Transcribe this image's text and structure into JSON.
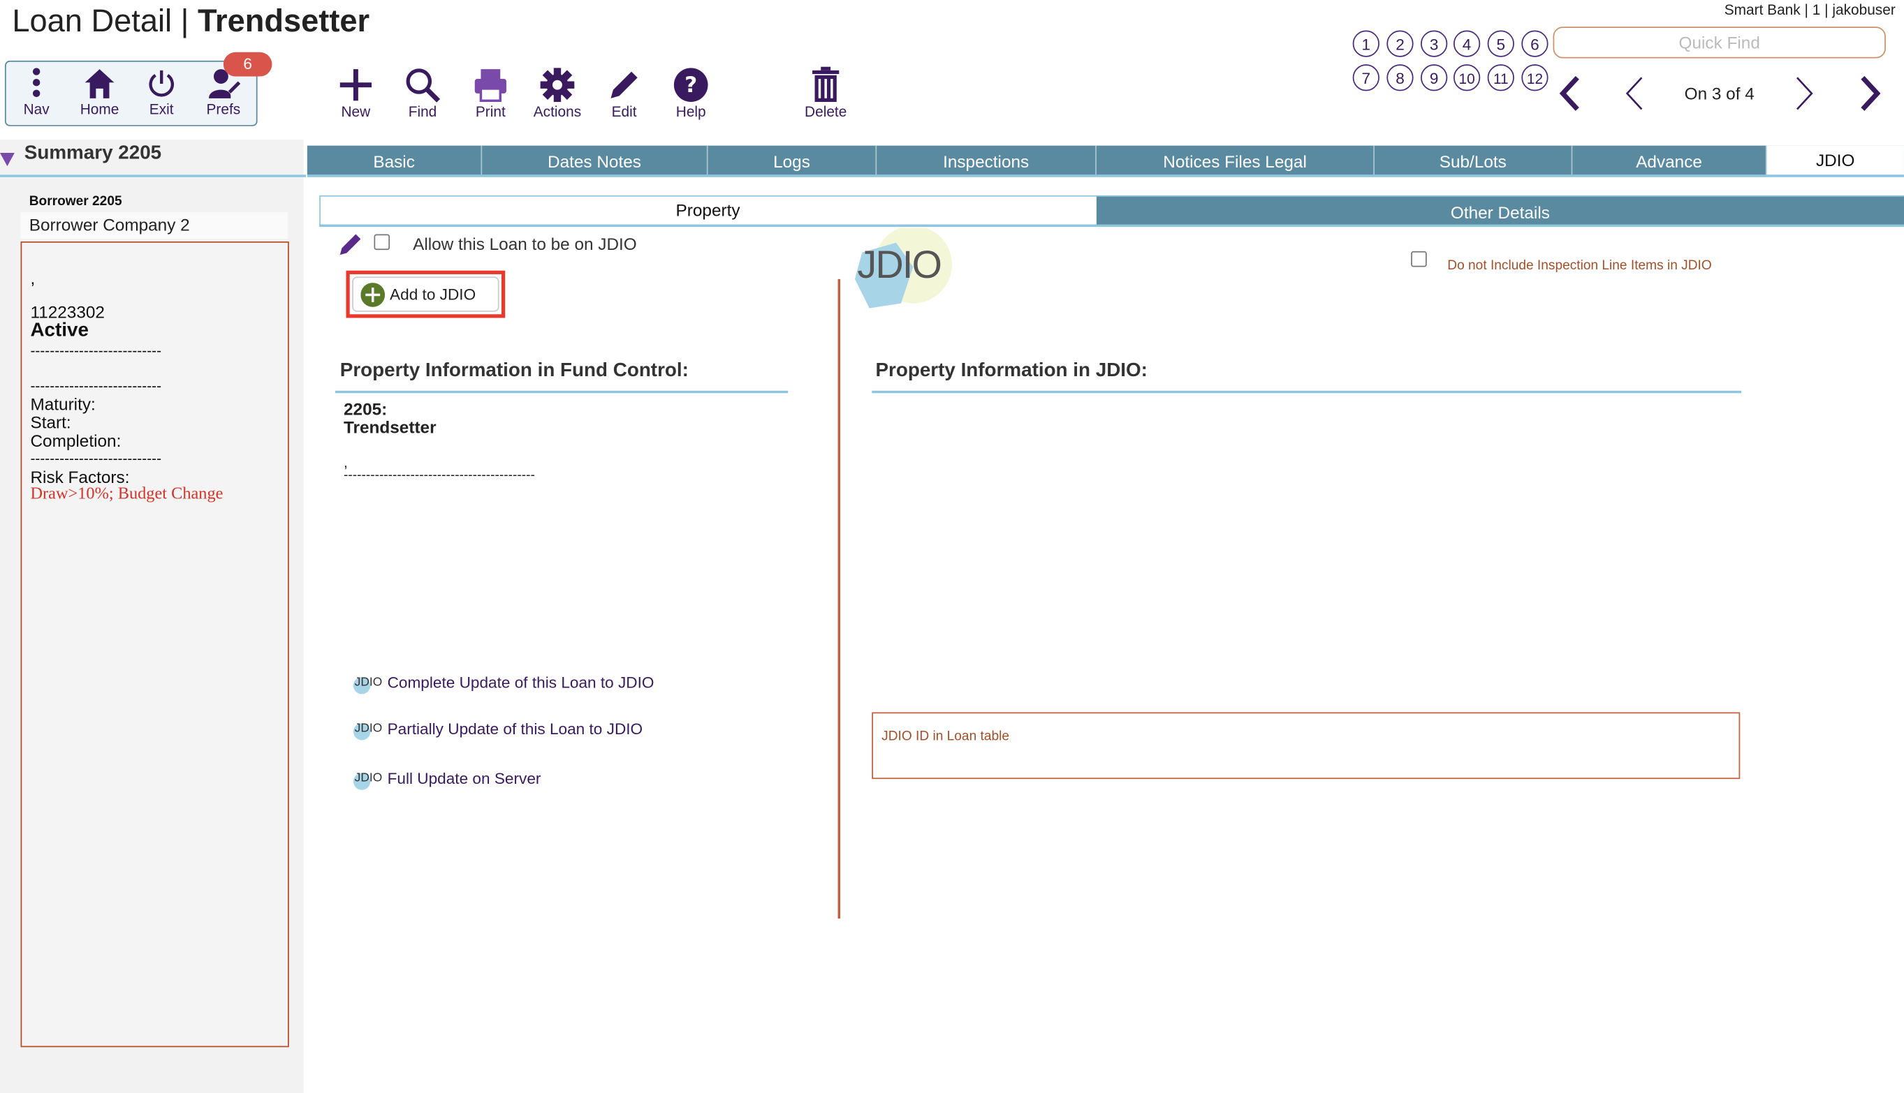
{
  "header": {
    "title_prefix": "Loan Detail | ",
    "title_bold": "Trendsetter",
    "user_info": "Smart Bank | 1 | jakobuser"
  },
  "nav": {
    "nav": "Nav",
    "home": "Home",
    "exit": "Exit",
    "prefs": "Prefs",
    "prefs_badge": "6"
  },
  "toolbar": {
    "new": "New",
    "find": "Find",
    "print": "Print",
    "actions": "Actions",
    "edit": "Edit",
    "help": "Help",
    "delete": "Delete"
  },
  "bookmarks": [
    "1",
    "2",
    "3",
    "4",
    "5",
    "6",
    "7",
    "8",
    "9",
    "10",
    "11",
    "12"
  ],
  "quickfind": {
    "placeholder": "Quick Find"
  },
  "record_nav": {
    "position": "On 3 of 4"
  },
  "summary": {
    "title": "Summary 2205",
    "borrower_label": "Borrower 2205",
    "borrower_name": "Borrower Company 2",
    "comma": ",",
    "loan_number": "11223302",
    "status": "Active",
    "dash1": "---------------------------",
    "dash2": "---------------------------",
    "maturity": "Maturity:",
    "start": "Start:",
    "completion": "Completion:",
    "dash3": "---------------------------",
    "risk_label": "Risk Factors:",
    "risk_values": "Draw>10%; Budget Change"
  },
  "tabs": [
    {
      "label": "Basic"
    },
    {
      "label": "Dates Notes"
    },
    {
      "label": "Logs"
    },
    {
      "label": "Inspections"
    },
    {
      "label": "Notices Files Legal"
    },
    {
      "label": "Sub/Lots"
    },
    {
      "label": "Advance"
    },
    {
      "label": "JDIO"
    }
  ],
  "subtabs": {
    "property": "Property",
    "other": "Other Details"
  },
  "jdio": {
    "allow_label": "Allow this Loan to be on JDIO",
    "add_button": "Add to JDIO",
    "logo_text": "JDIO",
    "do_not_include": "Do not Include Inspection Line Items in JDIO",
    "fc_heading": "Property Information in Fund Control:",
    "jdio_heading": "Property Information in JDIO:",
    "prop_id": "2205:",
    "prop_name": "Trendsetter",
    "prop_comma": ",",
    "prop_dash": "-------------------------------------------",
    "mini_logo": "JDIO",
    "link_complete": "Complete Update of this Loan to JDIO",
    "link_partial": "Partially Update of this Loan to JDIO",
    "link_full": "Full Update on Server",
    "id_label": "JDIO ID in Loan table"
  },
  "colors": {
    "accent_purple": "#3a1a5e",
    "tab_teal": "#5a8aa0",
    "highlight_red": "#e8392c",
    "risk_red": "#d3342a",
    "border_brown": "#c0603c"
  }
}
